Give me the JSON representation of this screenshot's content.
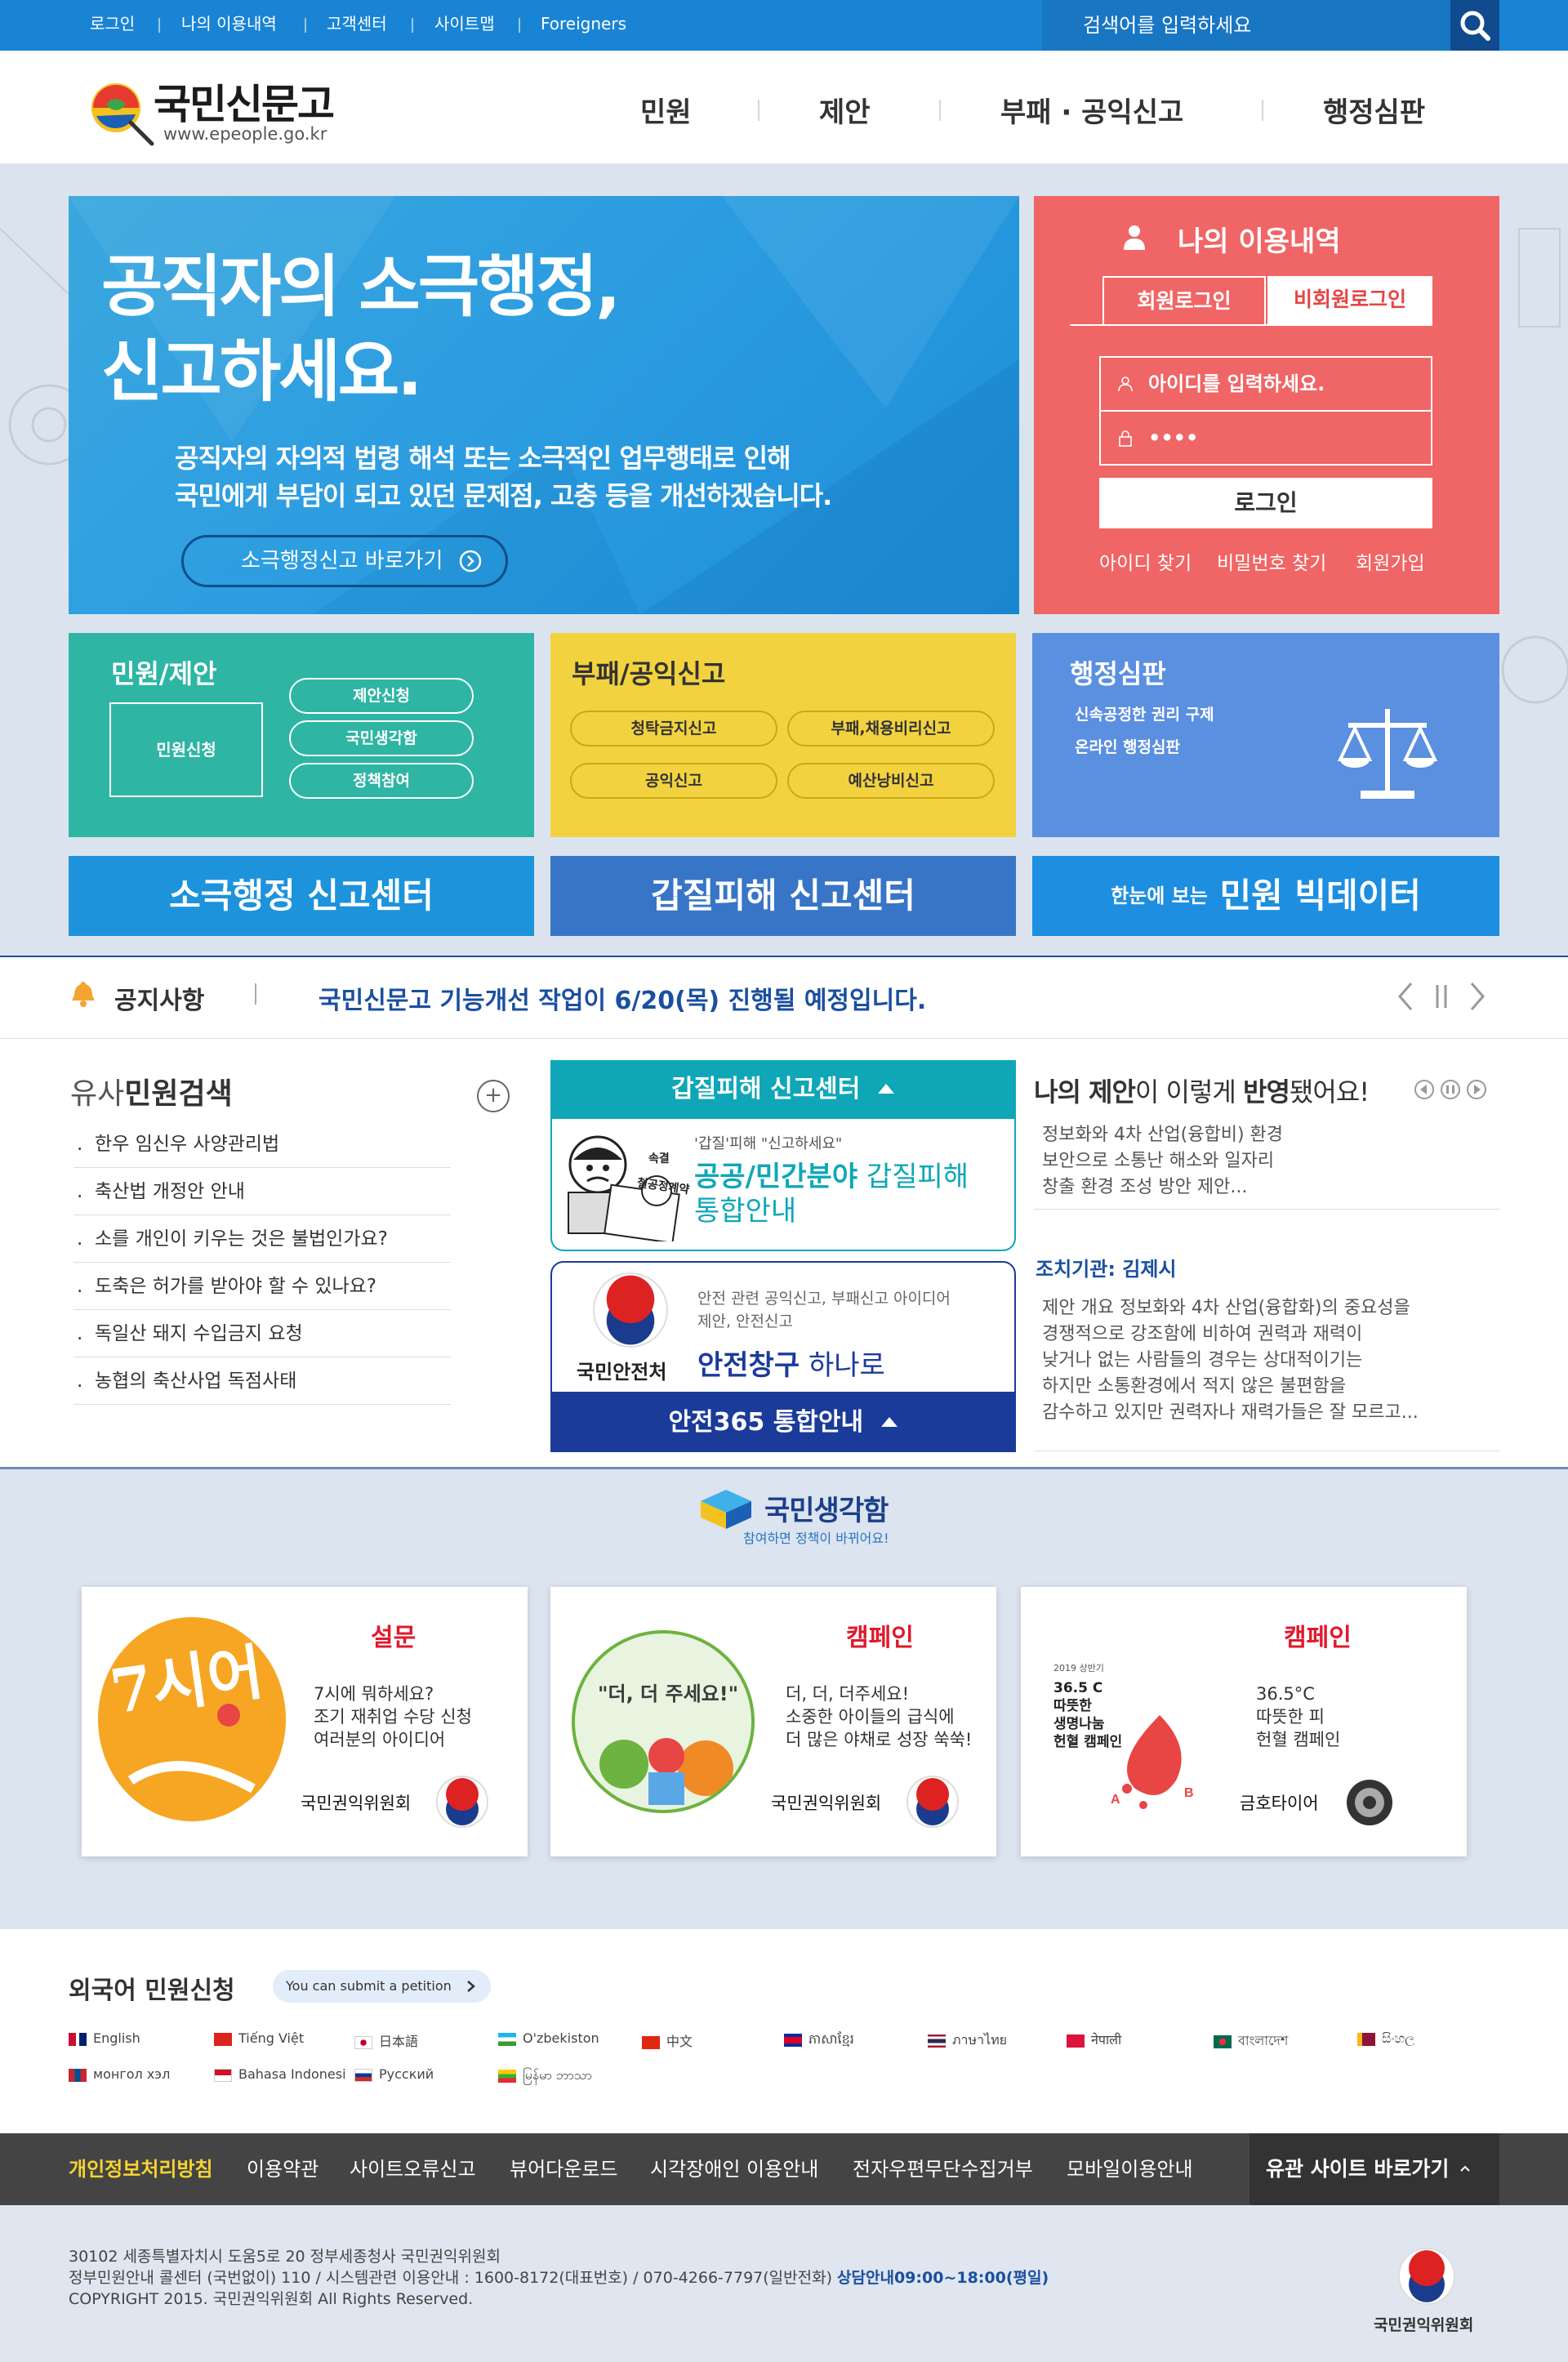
{
  "topbar": {
    "links": [
      "로그인",
      "나의 이용내역",
      "고객센터",
      "사이트맵",
      "Foreigners"
    ],
    "search_placeholder": "검색어를 입력하세요"
  },
  "header": {
    "logo_text": "국민신문고",
    "logo_url": "www.epeople.go.kr",
    "menu": [
      "민원",
      "제안",
      "부패 · 공익신고",
      "행정심판"
    ]
  },
  "banner": {
    "title_line1": "공직자의 소극행정,",
    "title_line2": "신고하세요.",
    "desc_line1": "공직자의 자의적 법령 해석 또는 소극적인 업무행태로 인해",
    "desc_line2": "국민에게 부담이 되고 있던 문제점, 고충 등을 개선하겠습니다.",
    "button": "소극행정신고 바로가기"
  },
  "login": {
    "title": "나의 이용내역",
    "tab_member": "회원로그인",
    "tab_nonmember": "비회원로그인",
    "id_placeholder": "아이디를 입력하세요.",
    "pw_value": "••••",
    "button": "로그인",
    "links": [
      "아이디 찾기",
      "비밀번호 찾기",
      "회원가입"
    ]
  },
  "boxes": {
    "civil": {
      "title": "민원/제안",
      "main": "민원신청",
      "pills": [
        "제안신청",
        "국민생각함",
        "정책참여"
      ]
    },
    "report": {
      "title": "부패/공익신고",
      "pills": [
        "청탁금지신고",
        "부패,채용비리신고",
        "공익신고",
        "예산낭비신고"
      ]
    },
    "trial": {
      "title": "행정심판",
      "lines": [
        "신속공정한 권리 구제",
        "온라인 행정심판"
      ]
    }
  },
  "bigbuttons": {
    "passive": "소극행정 신고센터",
    "gapjil": "갑질피해 신고센터",
    "bigdata_small": "한눈에 보는",
    "bigdata": "민원 빅데이터"
  },
  "notice": {
    "label": "공지사항",
    "text": "국민신문고 기능개선 작업이 6/20(목) 진행될 예정입니다."
  },
  "similar": {
    "title_prefix": "유사",
    "title_bold": "민원검색",
    "items": [
      "한우 임신우 사양관리법",
      "축산법 개정안 안내",
      "소를 개인이 키우는 것은 불법인가요?",
      "도축은 허가를 받아야 할 수 있나요?",
      "독일산 돼지 수입금지 요청",
      "농협의 축산사업 독점사태"
    ]
  },
  "gapjil": {
    "header": "갑질피해 신고센터",
    "sub": "'갑질'피해 \"신고하세요\"",
    "line1_bold": "공공/민간분야",
    "line1": "갑질피해",
    "line2": "통합안내",
    "img_label": "갑질",
    "img_label2": "철공정계약",
    "img_stamp": "속결"
  },
  "safety": {
    "org": "국민안전처",
    "desc_line1": "안전 관련 공익신고, 부패신고 아이디어",
    "desc_line2": "제안, 안전신고",
    "bold": "안전창구",
    "rest": "하나로",
    "footer": "안전365 통합안내"
  },
  "proposal": {
    "title_bold1": "나의 제안",
    "title_mid": "이 이렇게 ",
    "title_bold2": "반영",
    "title_end": "됐어요!",
    "text1": [
      "정보화와 4차 산업(융합비) 환경",
      "보안으로 소통난 해소와 일자리",
      "창출 환경 조성 방안 제안..."
    ],
    "org": "조치기관: 김제시",
    "text2": [
      "제안 개요 정보화와 4차 산업(융합화)의 중요성을",
      "경쟁적으로 강조함에 비하여 권력과 재력이",
      "낮거나 없는 사람들의 경우는 상대적이기는",
      "하지만 소통환경에서 적지 않은 불편함을",
      "감수하고 있지만 권력자나 재력가들은 잘 모르고..."
    ]
  },
  "think": {
    "title": "국민생각함",
    "sub": "참여하면 정책이 바뀌어요!"
  },
  "cards": [
    {
      "type": "설문",
      "lines": [
        "7시에 뭐하세요?",
        "조기 재취업 수당 신청",
        "여러분의 아이디어"
      ],
      "org": "국민권익위원회",
      "img": "7시어"
    },
    {
      "type": "캠페인",
      "lines": [
        "더, 더, 더주세요!",
        "소중한 아이들의 급식에",
        "더 많은 야채로 성장 쑥쑥!"
      ],
      "org": "국민권익위원회",
      "img": "\"더, 더 주세요!\""
    },
    {
      "type": "캠페인",
      "lines": [
        "36.5°C",
        "따뜻한 피",
        "헌혈 캠페인"
      ],
      "org": "금호타이어",
      "img_lines": [
        "2019 상반기",
        "36.5 C",
        "따뜻한",
        "생명나눔",
        "헌혈 캠페인"
      ]
    }
  ],
  "foreign": {
    "title": "외국어 민원신청",
    "badge": "You can submit a petition",
    "langs": [
      "English",
      "Tiếng Việt",
      "日本語",
      "O'zbekiston",
      "中文",
      "ភាសាខ្មែរ",
      "ภาษาไทย",
      "नेपाली",
      "বাংলাদেশ",
      "සිංහල",
      "монгол хэл",
      "Bahasa Indonesi",
      "Русский",
      "မြန်မာ ဘာသာ"
    ]
  },
  "footer_nav": {
    "highlight": "개인정보처리방침",
    "links": [
      "이용약관",
      "사이트오류신고",
      "뷰어다운로드",
      "시각장애인 이용안내",
      "전자우편무단수집거부",
      "모바일이용안내"
    ],
    "related": "유관 사이트 바로가기"
  },
  "footer": {
    "address": "30102 세종특별자치시 도움5로 20 정부세종청사 국민권익위원회",
    "phone": "정부민원안내 콜센터 (국번없이) 110 / 시스템관련 이용안내 : 1600-8172(대표번호) / 070-4266-7797(일반전화)",
    "hours": "상담안내09:00~18:00(평일)",
    "copyright": "COPYRIGHT 2015. 국민권익위원회 All Rights Reserved.",
    "org": "국민권익위원회"
  },
  "colors": {
    "blue": "#1a84d4",
    "red": "#f06565",
    "teal": "#2eb5a4",
    "yellow": "#f2d23f",
    "periwinkle": "#5b8fe0"
  }
}
